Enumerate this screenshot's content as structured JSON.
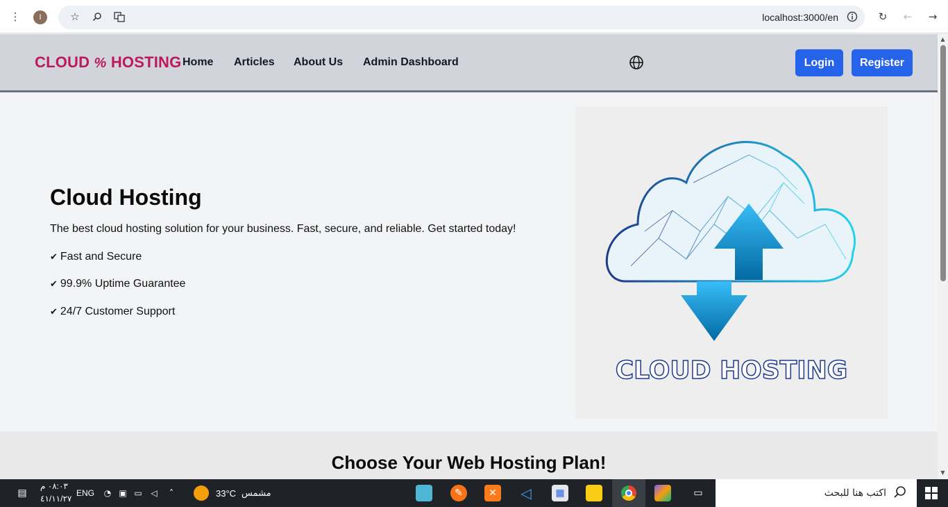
{
  "browser": {
    "url": "localhost:3000/en",
    "avatar_letter": "I"
  },
  "header": {
    "logo_left": "CLOUD",
    "logo_symbol": "%",
    "logo_right": "HOSTING",
    "nav": [
      "Home",
      "Articles",
      "About Us",
      "Admin Dashboard"
    ],
    "login": "Login",
    "register": "Register",
    "accent_color": "#be185d",
    "button_color": "#2563eb"
  },
  "hero": {
    "title": "Cloud Hosting",
    "description": "The best cloud hosting solution for your business. Fast, secure, and reliable. Get started today!",
    "features": [
      "Fast and Secure",
      "99.9% Uptime Guarantee",
      "24/7 Customer Support"
    ],
    "image_caption": "CLOUD HOSTING"
  },
  "plans": {
    "heading": "Choose Your Web Hosting Plan!"
  },
  "taskbar": {
    "time": "٠٨:٠٣ م",
    "date": "٤١/١١/٢٧",
    "lang": "ENG",
    "temperature": "33°C",
    "weather": "مشمس",
    "search_placeholder": "اكتب هنا للبحث"
  }
}
